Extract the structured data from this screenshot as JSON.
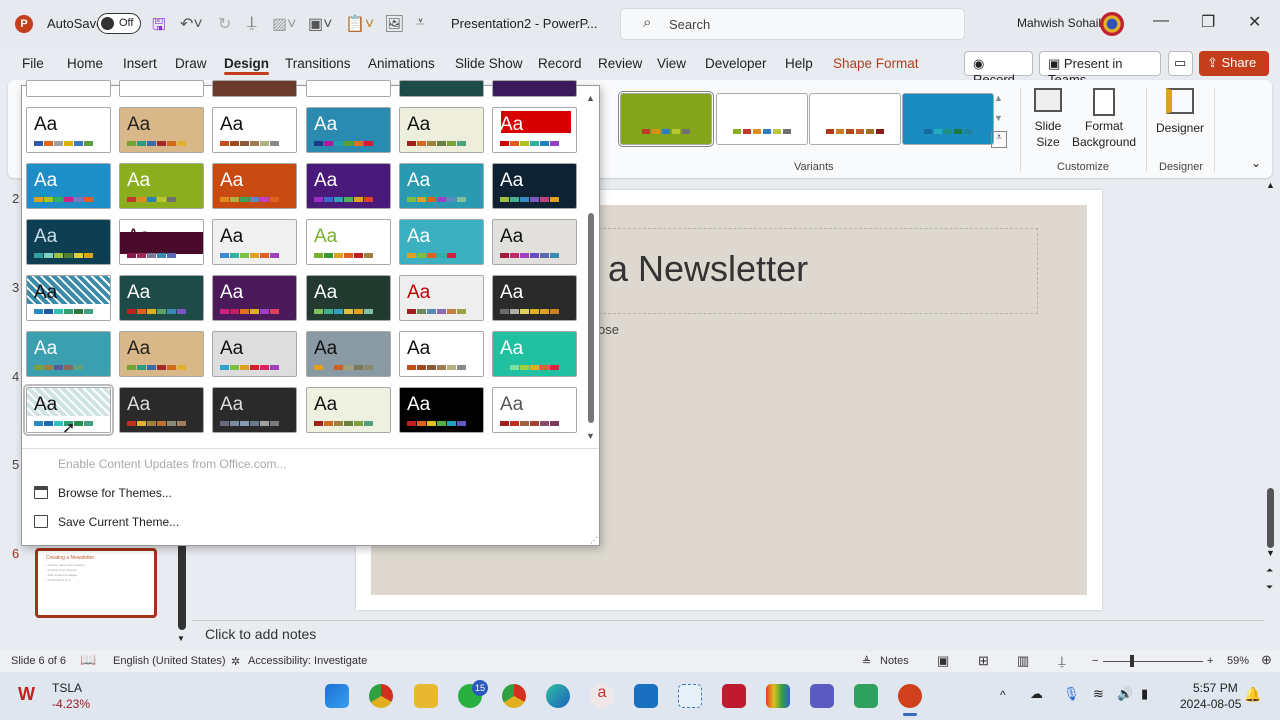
{
  "titlebar": {
    "autosave": "AutoSave",
    "autosave_state": "Off",
    "doc_title": "Presentation2  -  PowerP...",
    "search_placeholder": "Search",
    "user": "Mahwish Sohail"
  },
  "tabs": [
    "File",
    "Home",
    "Insert",
    "Draw",
    "Design",
    "Transitions",
    "Animations",
    "Slide Show",
    "Record",
    "Review",
    "View",
    "Developer",
    "Help",
    "Shape Format"
  ],
  "active_tab": "Design",
  "actions": {
    "record": "Record",
    "present_teams": "Present in Teams",
    "share": "Share"
  },
  "ribbon": {
    "variants_label": "Variants",
    "variants": [
      {
        "bg": "#84a41a",
        "swatches": [
          "#c0392b",
          "#e08a20",
          "#2e7fb8",
          "#b8c830",
          "#707070"
        ]
      },
      {
        "bg": "#ffffff",
        "swatches": [
          "#8aae1e",
          "#c0392b",
          "#e08a20",
          "#2e7fb8",
          "#b8c830",
          "#707070"
        ]
      },
      {
        "bg": "#ffffff",
        "swatches": [
          "#b03a1a",
          "#d07a20",
          "#b04a1a",
          "#c06030",
          "#a07020",
          "#8a1a1a"
        ]
      },
      {
        "bg": "#1a8cc0",
        "swatches": [
          "#1a6aa0",
          "#20b0c0",
          "#209080",
          "#1a7a40",
          "#2080a0"
        ]
      }
    ],
    "slide_size": "Slide Size",
    "format_background": "Format Background",
    "customize_label": "Customize",
    "designer": "Designer",
    "designer_label": "Designer"
  },
  "themes": {
    "sample_text": "Aa",
    "items": [
      {
        "bg": "#ffffff",
        "fg": "#111",
        "sw": [
          "#2e5aa8",
          "#e0651a",
          "#a0a0a0",
          "#e0b000",
          "#3a7ac0",
          "#5aa040"
        ]
      },
      {
        "bg": "#d8b888",
        "fg": "#222",
        "sw": [
          "#7aa030",
          "#2a9a7a",
          "#3a6aa8",
          "#a02a2a",
          "#d06a20",
          "#e0b030"
        ]
      },
      {
        "bg": "#ffffff",
        "fg": "#111",
        "sw": [
          "#c0501a",
          "#a04a20",
          "#8a5a3a",
          "#a07a50",
          "#b0b080",
          "#8a8a8a"
        ]
      },
      {
        "bg": "#2a8ab0",
        "fg": "#fff",
        "sw": [
          "#1a3a8a",
          "#b01a9a",
          "#20a0b0",
          "#5aa030",
          "#e07020",
          "#d02030"
        ]
      },
      {
        "bg": "#eeeedd",
        "fg": "#111",
        "sw": [
          "#a0201a",
          "#d06a20",
          "#a08040",
          "#6a8040",
          "#7aa040",
          "#50a080"
        ]
      },
      {
        "bg": "#ffffff",
        "fg": "#fff",
        "block": "#d80000",
        "sw": [
          "#d00000",
          "#e05a20",
          "#b0c020",
          "#30b0a0",
          "#2080c0",
          "#9040c0"
        ]
      },
      {
        "bg": "#1e8fc6",
        "fg": "#fff",
        "sw": [
          "#e0a020",
          "#b0c020",
          "#30b060",
          "#d02080",
          "#7a7ac0",
          "#e06020"
        ]
      },
      {
        "bg": "#8aae1e",
        "fg": "#fff",
        "sw": [
          "#c0392b",
          "#e08a20",
          "#2e7fb8",
          "#b8c830",
          "#707070"
        ]
      },
      {
        "bg": "#c84a10",
        "fg": "#fff",
        "sw": [
          "#e08a20",
          "#b0b040",
          "#40a060",
          "#5a8ac0",
          "#c040c0",
          "#e06020"
        ]
      },
      {
        "bg": "#4a1a7a",
        "fg": "#fff",
        "sw": [
          "#9a30c0",
          "#3a6ad0",
          "#30a0b0",
          "#50b060",
          "#e0a020",
          "#e04030"
        ]
      },
      {
        "bg": "#2a9ab0",
        "fg": "#fff",
        "sw": [
          "#7ac040",
          "#e0a020",
          "#e06020",
          "#a040c0",
          "#5a8ac0",
          "#80c0a0"
        ]
      },
      {
        "bg": "#0f2233",
        "fg": "#fff",
        "sw": [
          "#a0c040",
          "#40b090",
          "#3a8ac0",
          "#7a5ac0",
          "#c04080",
          "#e0a020"
        ]
      },
      {
        "bg": "#0e3e52",
        "fg": "#cde",
        "sw": [
          "#30a0a0",
          "#80d0c0",
          "#a0c040",
          "#508030",
          "#e0d040",
          "#e0a020"
        ]
      },
      {
        "bg": "#ffffff",
        "fg": "#4a0a2a",
        "block": "#4a0a2a",
        "sw": [
          "#8a1a4a",
          "#a02a5a",
          "#7a7a9a",
          "#3a8ab0",
          "#5a6ab0"
        ]
      },
      {
        "bg": "#f0f0f0",
        "fg": "#111",
        "sw": [
          "#3a8ad0",
          "#30b0a0",
          "#7ac040",
          "#e0a020",
          "#e06020",
          "#a040c0"
        ]
      },
      {
        "bg": "#ffffff",
        "fg": "#7ab030",
        "sw": [
          "#7ab030",
          "#3a9a30",
          "#e0a020",
          "#e06020",
          "#c02020",
          "#a08040"
        ]
      },
      {
        "bg": "#3bb0c0",
        "fg": "#fff",
        "sw": [
          "#e0a020",
          "#7ac040",
          "#e06020",
          "#30b0a0",
          "#d02040"
        ]
      },
      {
        "bg": "#e2e0dc",
        "fg": "#111",
        "sw": [
          "#a01a3a",
          "#c02a6a",
          "#a040c0",
          "#6a4ac0",
          "#5a6ab0",
          "#3a8ab0"
        ]
      },
      {
        "bg": "#3a8aaa",
        "fg": "#111",
        "pattern": true,
        "sw": [
          "#2a8ac0",
          "#1a5aa0",
          "#30c0b0",
          "#30a070",
          "#2a7a40",
          "#40a080"
        ]
      },
      {
        "bg": "#1e4a48",
        "fg": "#fff",
        "sw": [
          "#c02020",
          "#e06020",
          "#e0b020",
          "#60a060",
          "#3a8ab0",
          "#7a5ac0"
        ]
      },
      {
        "bg": "#4a1a5a",
        "fg": "#fff",
        "sw": [
          "#d02080",
          "#c02060",
          "#e07020",
          "#e0b020",
          "#a040c0",
          "#e04060"
        ]
      },
      {
        "bg": "#233a30",
        "fg": "#fff",
        "sw": [
          "#80c060",
          "#40b090",
          "#30a0c0",
          "#e0c040",
          "#e0a020",
          "#80c0a0"
        ]
      },
      {
        "bg": "#eeeeee",
        "fg": "#c00000",
        "sw": [
          "#a02020",
          "#6a8a60",
          "#5a8ab0",
          "#8a6ab0",
          "#c08040",
          "#a0a040"
        ]
      },
      {
        "bg": "#2a2a2a",
        "fg": "#fff",
        "sw": [
          "#6a6a6a",
          "#b0b0a0",
          "#e0d060",
          "#e0b020",
          "#e0a020",
          "#d08020"
        ]
      },
      {
        "bg": "#3aa0b0",
        "fg": "#fff",
        "sw": [
          "#7aa040",
          "#a08040",
          "#5a5a9a",
          "#8a6a5a",
          "#60a080"
        ]
      },
      {
        "bg": "#d8b888",
        "fg": "#222",
        "sw": [
          "#7aa030",
          "#2a9a7a",
          "#3a6aa8",
          "#a02a2a",
          "#d06a20",
          "#e0b030"
        ]
      },
      {
        "bg": "#dddddd",
        "fg": "#111",
        "sw": [
          "#30a0d0",
          "#7ac040",
          "#e0a020",
          "#d02030",
          "#e02060",
          "#a040c0"
        ]
      },
      {
        "bg": "#8a9aa5",
        "fg": "#111",
        "sw": [
          "#e0a020",
          "#8a9aa5",
          "#d06020",
          "#a0a080",
          "#7a7a5a",
          "#8a8a6a"
        ]
      },
      {
        "bg": "#ffffff",
        "fg": "#111",
        "sw": [
          "#c0501a",
          "#a04a20",
          "#8a5a3a",
          "#a07a50",
          "#b0b080",
          "#8a8a8a"
        ]
      },
      {
        "bg": "#20c0a0",
        "fg": "#fff",
        "sw": [
          "#20c0a0",
          "#80e0a0",
          "#a0d040",
          "#e0b020",
          "#e06030",
          "#e02040"
        ]
      },
      {
        "bg": "#cfe3e3",
        "fg": "#111",
        "pattern": true,
        "selected": true,
        "sw": [
          "#2a8ac0",
          "#1a6ab0",
          "#30c0c0",
          "#30a070",
          "#2a8a50",
          "#40a080"
        ]
      },
      {
        "bg": "#2a2a2a",
        "fg": "#ddd",
        "sw": [
          "#c03020",
          "#e0b030",
          "#a08040",
          "#c07030",
          "#8a8a7a",
          "#a08060"
        ]
      },
      {
        "bg": "#2a2a2a",
        "fg": "#ddd",
        "sw": [
          "#6a6a7a",
          "#7a8aa0",
          "#8a9ab0",
          "#6a7a8a",
          "#a0a0a0",
          "#7a7a7a"
        ]
      },
      {
        "bg": "#eef0e0",
        "fg": "#111",
        "sw": [
          "#a0201a",
          "#d06a20",
          "#a08040",
          "#6a8040",
          "#7aa040",
          "#50a080"
        ]
      },
      {
        "bg": "#000000",
        "fg": "#fff",
        "sw": [
          "#c02020",
          "#e06020",
          "#e0c020",
          "#50b040",
          "#20a0c0",
          "#5a5ac0"
        ]
      },
      {
        "bg": "#ffffff",
        "fg": "#555",
        "sw": [
          "#a02020",
          "#c03020",
          "#a06040",
          "#a04030",
          "#8a4a6a",
          "#7a3a5a"
        ]
      }
    ]
  },
  "gallery_menu": {
    "enable_updates": "Enable Content Updates from Office.com...",
    "browse": "Browse for Themes...",
    "save": "Save Current Theme..."
  },
  "slides": {
    "numbers": [
      "2",
      "3",
      "4",
      "5",
      "6"
    ],
    "thumb_title": "Creating a Newsletter",
    "thumb_lines": [
      "• Choose paper size & layout",
      "• Choose color scheme",
      "• Add content & images",
      "• Proofread & print"
    ]
  },
  "slide": {
    "title": "a Newsletter",
    "body": "ose"
  },
  "notes_placeholder": "Click to add notes",
  "status": {
    "slide": "Slide 6 of 6",
    "language": "English (United States)",
    "accessibility": "Accessibility: Investigate",
    "notes": "Notes",
    "zoom": "59%"
  },
  "taskbar": {
    "stock": "TSLA",
    "stock_change": "-4.23%",
    "whatsapp_badge": "15",
    "time": "5:57 PM",
    "date": "2024-08-05"
  }
}
